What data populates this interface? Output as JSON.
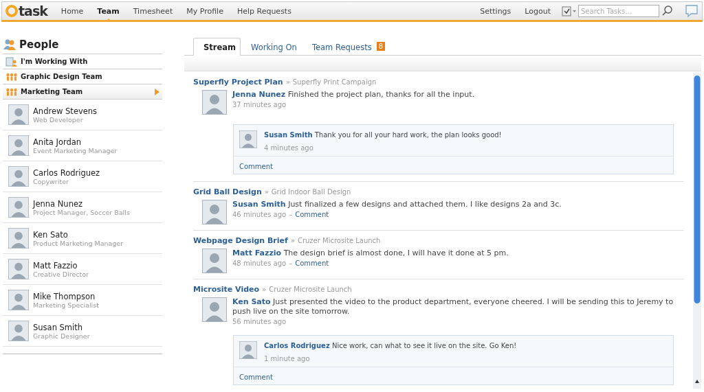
{
  "nav": {
    "logo": "task",
    "items": [
      {
        "label": "Home",
        "selected": false
      },
      {
        "label": "Team",
        "selected": true
      },
      {
        "label": "Timesheet",
        "selected": false
      },
      {
        "label": "My Profile",
        "selected": false
      },
      {
        "label": "Help Requests",
        "selected": false
      }
    ],
    "links": [
      "Settings",
      "Logout"
    ],
    "search": {
      "placeholder": "Search Tasks..."
    }
  },
  "sidebar": {
    "title": "People",
    "groups": [
      {
        "label": "I'm Working With",
        "kind": "contacts",
        "selected": false
      },
      {
        "label": "Graphic Design Team",
        "kind": "team",
        "selected": false
      },
      {
        "label": "Marketing Team",
        "kind": "team",
        "selected": true
      }
    ],
    "people": [
      {
        "name": "Andrew Stevens",
        "role": "Web Developer"
      },
      {
        "name": "Anita Jordan",
        "role": "Event Marketing Manager"
      },
      {
        "name": "Carlos Rodriguez",
        "role": "Copywriter"
      },
      {
        "name": "Jenna Nunez",
        "role": "Project Manager, Soccer Balls"
      },
      {
        "name": "Ken Sato",
        "role": "Product Marketing Manager"
      },
      {
        "name": "Matt Fazzio",
        "role": "Creative Director"
      },
      {
        "name": "Mike Thompson",
        "role": "Marketing Specialist"
      },
      {
        "name": "Susan Smith",
        "role": "Graphic Designer"
      }
    ]
  },
  "tabs": [
    {
      "label": "Stream",
      "selected": true
    },
    {
      "label": "Working On",
      "selected": false
    },
    {
      "label": "Team Requests",
      "selected": false,
      "badge": "8"
    }
  ],
  "stream": [
    {
      "project": "Superfly Project Plan",
      "sep": "»",
      "parent": "Superfly Print Campaign",
      "author": "Jenna Nunez",
      "text": "Finished the project plan, thanks for all the input.",
      "time": "37 minutes ago",
      "comment": "Comment",
      "replies": [
        {
          "author": "Susan Smith",
          "text": "Thank you for all your hard work, the plan looks good!",
          "time": "4 minutes ago"
        }
      ]
    },
    {
      "project": "Grid Ball Design",
      "sep": "»",
      "parent": "Grid Indoor Ball Design",
      "author": "Susan Smith",
      "text": "Just finalized a few designs and attached them.  I like designs 2a and 3c.",
      "time": "46 minutes ago",
      "dash": "–",
      "comment": "Comment"
    },
    {
      "project": "Webpage Design Brief",
      "sep": "»",
      "parent": "Cruzer Microsite Launch",
      "author": "Matt Fazzio",
      "text": "The design brief is almost done, I will have it done at 5 pm.",
      "time": "48 minutes ago",
      "dash": "–",
      "comment": "Comment"
    },
    {
      "project": "Microsite Video",
      "sep": "»",
      "parent": "Cruzer Microsite Launch",
      "author": "Ken Sato",
      "text": "Just presented the video to the product department, everyone cheered.  I will be sending this to Jeremy to push live on the site tomorrow.",
      "time": "56 minutes ago",
      "comment": "Comment",
      "replies": [
        {
          "author": "Carlos Rodriguez",
          "text": "Nice work, can what to see it live on the site. Go Ken!",
          "time": "1 minute ago"
        }
      ]
    }
  ]
}
